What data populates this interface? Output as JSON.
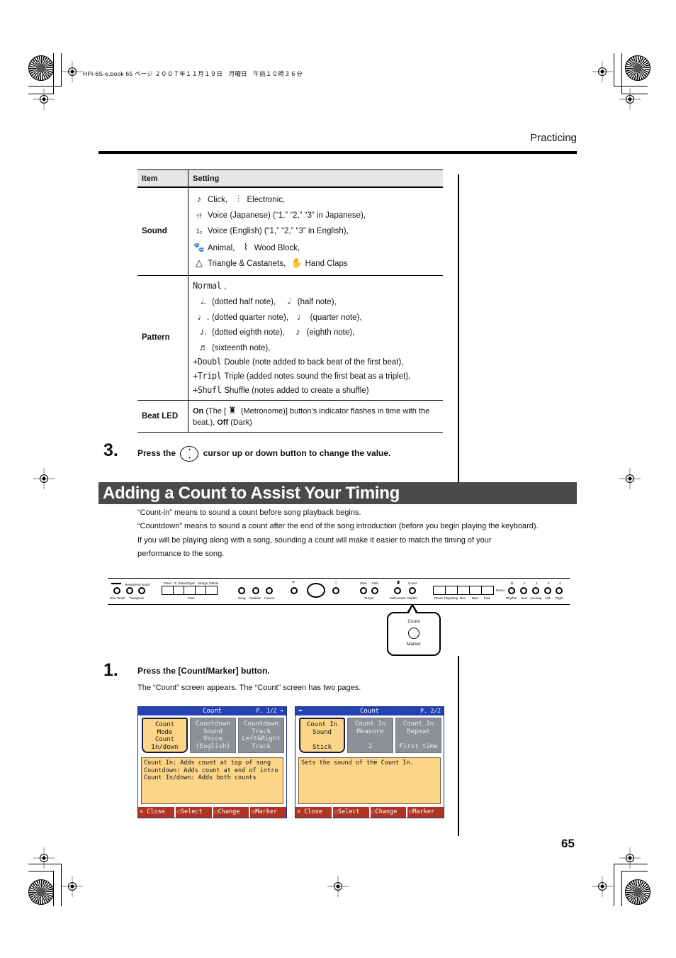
{
  "print_info": "HPi-6S-e.book  65 ページ  ２００７年１１月１９日　月曜日　午前１０時３６分",
  "header": {
    "section": "Practicing"
  },
  "settings_table": {
    "headers": [
      "Item",
      "Setting"
    ],
    "rows": {
      "sound": {
        "item": "Sound",
        "lines": [
          [
            {
              "icon": "metronome-click-icon",
              "glyph": "♪",
              "text": "Click,"
            },
            {
              "icon": "electronic-icon",
              "glyph": "⫶",
              "text": "Electronic,"
            }
          ],
          [
            {
              "icon": "voice-japanese-icon",
              "glyph": "ｲﾁ",
              "text": "Voice (Japanese) (“1,” “2,” “3” in Japanese),"
            }
          ],
          [
            {
              "icon": "voice-english-icon",
              "glyph": "1₂",
              "text": "Voice (English) (“1,” “2,” “3” in English),"
            }
          ],
          [
            {
              "icon": "animal-icon",
              "glyph": "🐾",
              "text": "Animal,"
            },
            {
              "icon": "wood-block-icon",
              "glyph": "⌇",
              "text": "Wood Block,"
            }
          ],
          [
            {
              "icon": "triangle-castanets-icon",
              "glyph": "△",
              "text": "Triangle & Castanets,"
            },
            {
              "icon": "hand-claps-icon",
              "glyph": "✋",
              "text": "Hand Claps"
            }
          ]
        ]
      },
      "pattern": {
        "item": "Pattern",
        "normal_label": "Normal",
        "normal_suffix": ",",
        "notes": [
          [
            {
              "icon": "dotted-half-note-icon",
              "glyph": "𝅗𝅥.",
              "text": "(dotted half note),"
            },
            {
              "icon": "half-note-icon",
              "glyph": "𝅗𝅥",
              "text": "(half note),"
            }
          ],
          [
            {
              "icon": "dotted-quarter-note-icon",
              "glyph": "♩.",
              "text": "(dotted quarter note),"
            },
            {
              "icon": "quarter-note-icon",
              "glyph": "♩",
              "text": "(quarter note),"
            }
          ],
          [
            {
              "icon": "dotted-eighth-note-icon",
              "glyph": "♪.",
              "text": "(dotted eighth note),"
            },
            {
              "icon": "eighth-note-icon",
              "glyph": "♪",
              "text": "(eighth note),"
            }
          ],
          [
            {
              "icon": "sixteenth-note-icon",
              "glyph": "♬",
              "text": "(sixteenth note),"
            }
          ]
        ],
        "variants": [
          {
            "lcd": "+Doubl",
            "text": "Double (note added to back beat of the first beat),"
          },
          {
            "lcd": "+Tripl",
            "text": "Triple (added notes sound the first beat as a triplet),"
          },
          {
            "lcd": "+Shufl",
            "text": "Shuffle (notes added to create a shuffle)"
          }
        ]
      },
      "beat_led": {
        "item": "Beat LED",
        "on_label": "On",
        "on_text_pre": "(The [",
        "on_text_post": "(Metronome)] button’s indicator flashes in time with the beat.),",
        "off_label": "Off",
        "off_text": "(Dark)"
      }
    }
  },
  "step3": {
    "number": "3.",
    "pre": "Press the",
    "post": "cursor up or down button to change the value."
  },
  "section": {
    "title": "Adding a Count to Assist Your Timing",
    "paragraphs": [
      "“Count-in” means to sound a count before song playback begins.",
      "“Countdown” means to sound a count after the end of the song introduction (before you begin playing the keyboard).",
      "If you will be playing along with a song, sounding a count will make it easier to match the timing of your performance to the song."
    ]
  },
  "panel": {
    "left_labels": [
      "One Touch",
      "Reverb",
      "Key Touch",
      "Transpose"
    ],
    "tone_labels": [
      "Piano",
      "E. Piano",
      "Organ",
      "Strings",
      "Others"
    ],
    "tone_caption": "Tone",
    "mid_labels": [
      "Song",
      "Notation",
      "Lesson"
    ],
    "cursor_labels": [
      "×",
      "○"
    ],
    "tempo_labels": [
      "Slow",
      "Fast",
      "Tempo"
    ],
    "metronome_label": "Metronome",
    "count_top": "Count",
    "count_bottom": "Marker",
    "transport_labels": [
      "Reset",
      "Play/Stop",
      "Rec",
      "Bwd",
      "Fwd"
    ],
    "demo_label": "Demo",
    "track_numbers": [
      "R",
      "1",
      "2",
      "3",
      "4"
    ],
    "track_labels": [
      "Rhythm",
      "User",
      "Accomp",
      "Left",
      "Right"
    ],
    "callout": {
      "top": "Count",
      "bottom": "Marker"
    }
  },
  "step1": {
    "number": "1.",
    "text": "Press the [Count/Marker] button.",
    "sub": "The “Count” screen appears. The “Count” screen has two pages."
  },
  "screens": [
    {
      "title": "Count",
      "page": "P. 1/2 ➡",
      "back": "",
      "tiles": [
        {
          "text": "Count\nMode\nCount\nIn/down",
          "selected": true
        },
        {
          "text": "Countdown\nSound\nVoice\n(English)",
          "selected": false
        },
        {
          "text": "Countdown\nTrack\nLeft&Right\nTrack",
          "selected": false
        }
      ],
      "description": "Count In: Adds count at top of song\nCountdown: Adds count at end of intro\nCount In/down: Adds both counts",
      "buttons": [
        "× Close",
        "◌Select",
        "◌Change",
        "○Marker"
      ]
    },
    {
      "title": "Count",
      "page": "P. 2/2",
      "back": "⬅",
      "tiles": [
        {
          "text": "Count In\nSound\n\nStick",
          "selected": true
        },
        {
          "text": "Count In\nMeasure\n\n2",
          "selected": false
        },
        {
          "text": "Count In\nRepeat\n\nFirst time",
          "selected": false
        }
      ],
      "description": "Sets the sound of the Count In.",
      "buttons": [
        "× Close",
        "◌Select",
        "◌Change",
        "○Marker"
      ]
    }
  ],
  "page_number": "65"
}
